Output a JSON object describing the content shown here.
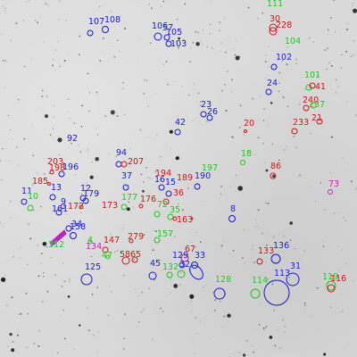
{
  "colors": {
    "blue": "#1616d8",
    "red": "#d01010",
    "green": "#18c818",
    "magenta": "#c020c0"
  },
  "image": {
    "kind": "astronomical-field",
    "background": "noisy light-grey sky with dark star points",
    "scale": "grayscale inverted"
  },
  "labels": [
    {
      "id": "n111",
      "text": "111",
      "color": "green"
    },
    {
      "id": "n30",
      "text": "30",
      "color": "red"
    },
    {
      "id": "n228",
      "text": "228",
      "color": "red"
    },
    {
      "id": "n104",
      "text": "104",
      "color": "green"
    },
    {
      "id": "n107",
      "text": "107",
      "color": "blue"
    },
    {
      "id": "n108",
      "text": "108",
      "color": "blue"
    },
    {
      "id": "n106",
      "text": "106",
      "color": "blue"
    },
    {
      "id": "n57",
      "text": "57",
      "color": "blue"
    },
    {
      "id": "n105",
      "text": "105",
      "color": "blue"
    },
    {
      "id": "n103",
      "text": "103",
      "color": "blue"
    },
    {
      "id": "n102",
      "text": "102",
      "color": "blue"
    },
    {
      "id": "n101",
      "text": "101",
      "color": "green"
    },
    {
      "id": "n24",
      "text": "24",
      "color": "blue"
    },
    {
      "id": "n41",
      "text": "41",
      "color": "red"
    },
    {
      "id": "n240",
      "text": "240",
      "color": "red"
    },
    {
      "id": "n237",
      "text": "237",
      "color": "green"
    },
    {
      "id": "n233",
      "text": "233",
      "color": "red"
    },
    {
      "id": "n21",
      "text": "21",
      "color": "red"
    },
    {
      "id": "n23",
      "text": "23",
      "color": "blue"
    },
    {
      "id": "n26",
      "text": "26",
      "color": "blue"
    },
    {
      "id": "n42",
      "text": "42",
      "color": "blue"
    },
    {
      "id": "n20",
      "text": "20",
      "color": "red"
    },
    {
      "id": "n92",
      "text": "92",
      "color": "blue"
    },
    {
      "id": "n94",
      "text": "94",
      "color": "blue"
    },
    {
      "id": "n207",
      "text": "207",
      "color": "red"
    },
    {
      "id": "n18",
      "text": "18",
      "color": "green"
    },
    {
      "id": "n86",
      "text": "86",
      "color": "red"
    },
    {
      "id": "n203",
      "text": "203",
      "color": "red"
    },
    {
      "id": "n198",
      "text": "198",
      "color": "red"
    },
    {
      "id": "n196",
      "text": "196",
      "color": "blue"
    },
    {
      "id": "n197",
      "text": "197",
      "color": "green"
    },
    {
      "id": "n194",
      "text": "194",
      "color": "red"
    },
    {
      "id": "n189",
      "text": "189",
      "color": "red"
    },
    {
      "id": "n190",
      "text": "190",
      "color": "blue"
    },
    {
      "id": "n185",
      "text": "185",
      "color": "red"
    },
    {
      "id": "n37",
      "text": "37",
      "color": "blue"
    },
    {
      "id": "n16",
      "text": "16",
      "color": "blue"
    },
    {
      "id": "n15",
      "text": "15",
      "color": "blue"
    },
    {
      "id": "n73",
      "text": "73",
      "color": "magenta"
    },
    {
      "id": "n11",
      "text": "11",
      "color": "blue"
    },
    {
      "id": "n13",
      "text": "13",
      "color": "blue"
    },
    {
      "id": "n12",
      "text": "12",
      "color": "blue"
    },
    {
      "id": "n179",
      "text": "179",
      "color": "blue"
    },
    {
      "id": "n36",
      "text": "36",
      "color": "red"
    },
    {
      "id": "n10",
      "text": "10",
      "color": "green"
    },
    {
      "id": "n177",
      "text": "177",
      "color": "green"
    },
    {
      "id": "n176",
      "text": "176",
      "color": "red"
    },
    {
      "id": "n173",
      "text": "173",
      "color": "red"
    },
    {
      "id": "n72",
      "text": "72",
      "color": "green"
    },
    {
      "id": "n161",
      "text": "161",
      "color": "blue"
    },
    {
      "id": "n9",
      "text": "9",
      "color": "blue"
    },
    {
      "id": "n172",
      "text": "172",
      "color": "red"
    },
    {
      "id": "n35",
      "text": "35",
      "color": "green"
    },
    {
      "id": "n8",
      "text": "8",
      "color": "blue"
    },
    {
      "id": "n163",
      "text": "163",
      "color": "red"
    },
    {
      "id": "n34",
      "text": "34",
      "color": "blue"
    },
    {
      "id": "n158",
      "text": "158",
      "color": "blue"
    },
    {
      "id": "n157",
      "text": "157",
      "color": "green"
    },
    {
      "id": "n279",
      "text": "279",
      "color": "red"
    },
    {
      "id": "n4",
      "text": "4",
      "color": "green"
    },
    {
      "id": "n147",
      "text": "147",
      "color": "red"
    },
    {
      "id": "n134",
      "text": "134",
      "color": "magenta"
    },
    {
      "id": "n312",
      "text": "312",
      "color": "green"
    },
    {
      "id": "n136",
      "text": "136",
      "color": "blue"
    },
    {
      "id": "n67",
      "text": "67",
      "color": "red"
    },
    {
      "id": "n133",
      "text": "133",
      "color": "red"
    },
    {
      "id": "n47",
      "text": "47",
      "color": "green"
    },
    {
      "id": "n58",
      "text": "58",
      "color": "red"
    },
    {
      "id": "n65",
      "text": "65",
      "color": "red"
    },
    {
      "id": "n129",
      "text": "129",
      "color": "blue"
    },
    {
      "id": "n33",
      "text": "33",
      "color": "blue"
    },
    {
      "id": "n125",
      "text": "125",
      "color": "blue"
    },
    {
      "id": "n45",
      "text": "45",
      "color": "blue"
    },
    {
      "id": "n32",
      "text": "32",
      "color": "blue"
    },
    {
      "id": "n31",
      "text": "31",
      "color": "blue"
    },
    {
      "id": "n132",
      "text": "132",
      "color": "green"
    },
    {
      "id": "n113",
      "text": "113",
      "color": "blue"
    },
    {
      "id": "n119",
      "text": "119",
      "color": "green"
    },
    {
      "id": "n116",
      "text": "116",
      "color": "red"
    },
    {
      "id": "n128",
      "text": "128",
      "color": "green"
    },
    {
      "id": "n114",
      "text": "114",
      "color": "green"
    }
  ]
}
